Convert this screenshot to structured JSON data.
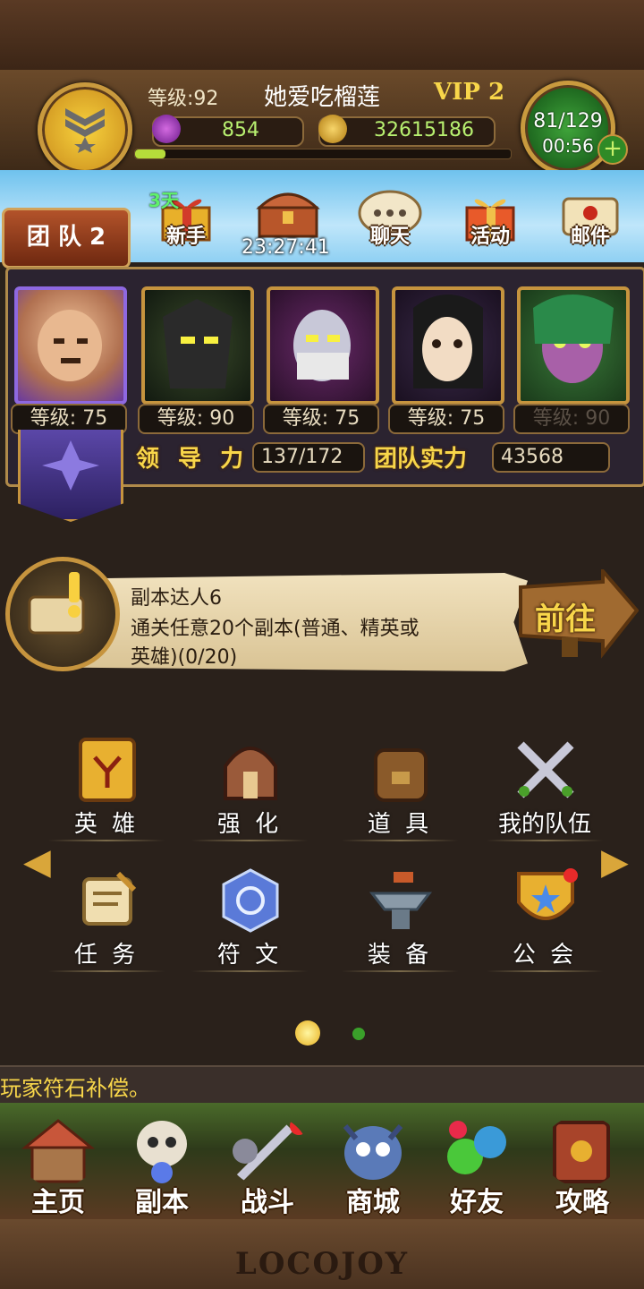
{
  "header": {
    "level_text": "等级:92",
    "player_name": "她爱吃榴莲",
    "vip": "VIP 2",
    "gems": "854",
    "coins": "32615186",
    "energy": "81/129",
    "energy_timer": "00:56",
    "xp_progress": 0.08
  },
  "top_menu": {
    "team_label": "团 队 2",
    "novice_days": "3天",
    "novice_label": "新手",
    "chest_timer": "23:27:41",
    "chat_label": "聊天",
    "activity_label": "活动",
    "mail_label": "邮件"
  },
  "team": {
    "heroes": [
      {
        "level": "等级: 75",
        "locked": false
      },
      {
        "level": "等级: 90",
        "locked": false
      },
      {
        "level": "等级: 75",
        "locked": false
      },
      {
        "level": "等级: 75",
        "locked": false
      },
      {
        "level": "等级: 90",
        "locked": true
      }
    ],
    "leadership_label": "领 导 力",
    "leadership_value": "137/172",
    "power_label": "团队实力",
    "power_value": "43568"
  },
  "quest": {
    "title": "副本达人6",
    "desc_line1": "通关任意20个副本(普通、精英或",
    "desc_line2": "英雄)(0/20)",
    "goto_label": "前往"
  },
  "menu": {
    "items": [
      {
        "label": "英 雄",
        "icon": "hero-book-icon"
      },
      {
        "label": "强 化",
        "icon": "helmet-icon"
      },
      {
        "label": "道 具",
        "icon": "backpack-icon"
      },
      {
        "label": "我的队伍",
        "icon": "crossed-swords-icon"
      },
      {
        "label": "任 务",
        "icon": "scroll-icon"
      },
      {
        "label": "符 文",
        "icon": "rune-gem-icon"
      },
      {
        "label": "装 备",
        "icon": "anvil-icon"
      },
      {
        "label": "公 会",
        "icon": "guild-shield-icon"
      }
    ],
    "page": 1,
    "page_count": 2
  },
  "ticker": "玩家符石补偿。",
  "bottom_nav": [
    "主页",
    "副本",
    "战斗",
    "商城",
    "好友",
    "攻略"
  ],
  "footer_logo": "LOCOJOY",
  "colors": {
    "gold": "#f8d64a",
    "wood": "#5a3a24",
    "panel": "#2b2330"
  }
}
